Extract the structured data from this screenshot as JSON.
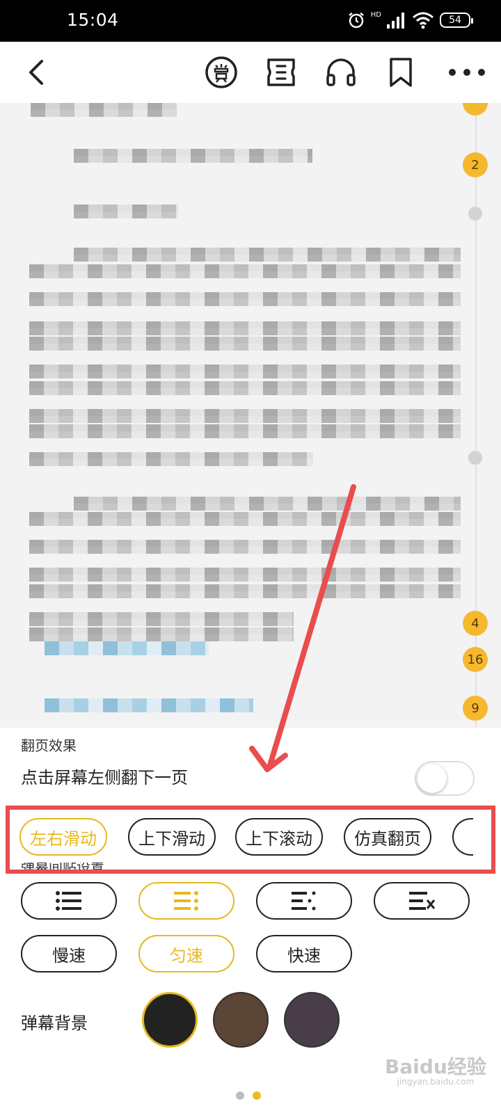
{
  "status_bar": {
    "time": "15:04",
    "network": "HD",
    "battery": "54"
  },
  "reader": {
    "badges": [
      {
        "count": "2"
      },
      {
        "count": "4"
      },
      {
        "count": "16"
      },
      {
        "count": "9"
      }
    ]
  },
  "settings": {
    "page_turn_title": "翻页效果",
    "left_tap_label": "点击屏幕左侧翻下一页",
    "left_tap_enabled": false,
    "page_turn_options": [
      "左右滑动",
      "上下滑动",
      "上下滚动",
      "仿真翻页"
    ],
    "page_turn_selected": "左右滑动",
    "danmaku_spacing_title": "弹幕间贴设置",
    "danmaku_spacing_icons": [
      "list-dense-icon",
      "list-medium-icon",
      "list-sparse-icon",
      "list-off-icon"
    ],
    "danmaku_spacing_selected": "list-medium-icon",
    "speed_options": [
      "慢速",
      "匀速",
      "快速"
    ],
    "speed_selected": "匀速",
    "danmaku_bg_label": "弹幕背景",
    "bg_colors": [
      "#222222",
      "#5a4536",
      "#4a3d4a"
    ],
    "bg_selected": "#222222",
    "accent_color": "#e6b91e"
  },
  "watermark": {
    "brand": "Baidu经验",
    "url": "jingyan.baidu.com"
  }
}
